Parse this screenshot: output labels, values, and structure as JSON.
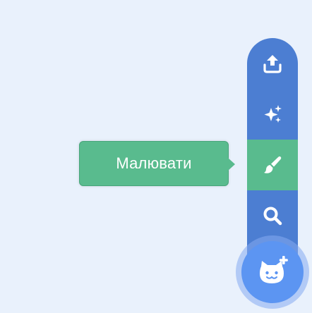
{
  "colors": {
    "background": "#e9f1fc",
    "menu": "#4c7ed2",
    "active": "#59bb8e",
    "main_button": "#5c95f2",
    "icon": "#ffffff"
  },
  "menu": {
    "items": [
      {
        "icon": "upload-icon",
        "active": false
      },
      {
        "icon": "sparkle-icon",
        "active": false
      },
      {
        "icon": "paintbrush-icon",
        "active": true
      },
      {
        "icon": "search-icon",
        "active": false
      }
    ]
  },
  "main_button": {
    "icon": "cat-plus-icon"
  },
  "tooltip": {
    "text": "Малювати"
  }
}
